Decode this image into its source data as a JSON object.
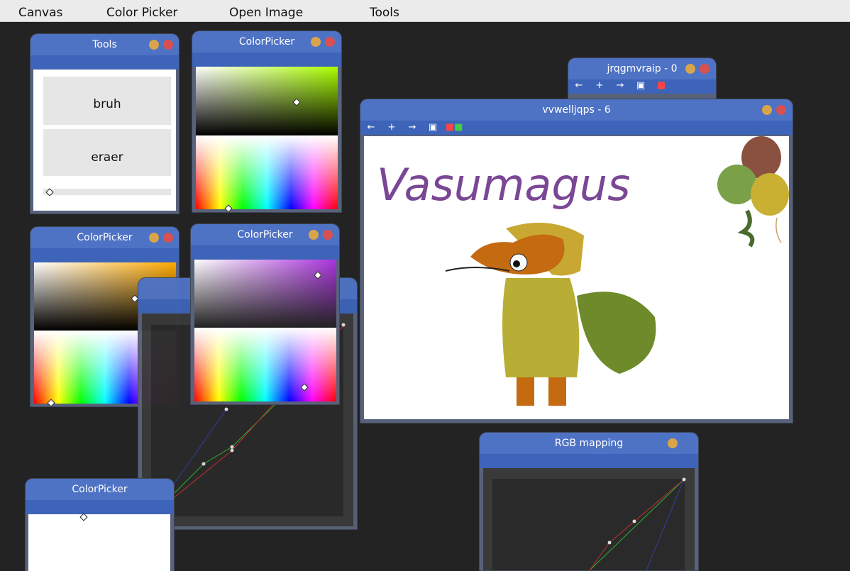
{
  "menu": [
    "Canvas",
    "Color Picker",
    "Open Image",
    "Tools"
  ],
  "tools_window": {
    "title": "Tools",
    "buttons": [
      "bruh",
      "eraer"
    ],
    "slider_value": 0.05
  },
  "colorpicker_windows": [
    {
      "title": "ColorPicker",
      "hue_color": "#aaff00"
    },
    {
      "title": "ColorPicker",
      "hue_color": "#ffaa00"
    },
    {
      "title": "ColorPicker",
      "hue_color": "#aa33dd"
    },
    {
      "title": "ColorPicker",
      "hue_color": "#ffffff"
    }
  ],
  "canvas_windows": [
    {
      "title": "jrqgmvraip - 0"
    },
    {
      "title": "vvwelljqps - 6",
      "drawing_text": "Vasumagus"
    }
  ],
  "rgb_window": {
    "title": "RGB mapping"
  },
  "toolbar_icons": [
    "arrow-left-icon",
    "plus-icon",
    "arrow-right-icon",
    "save-icon",
    "rgb-icon"
  ],
  "colors": {
    "titlebar": "#4e72c4",
    "window_body": "#58627a",
    "background": "#232323",
    "minimize": "#d9a54a",
    "close": "#d95050"
  }
}
